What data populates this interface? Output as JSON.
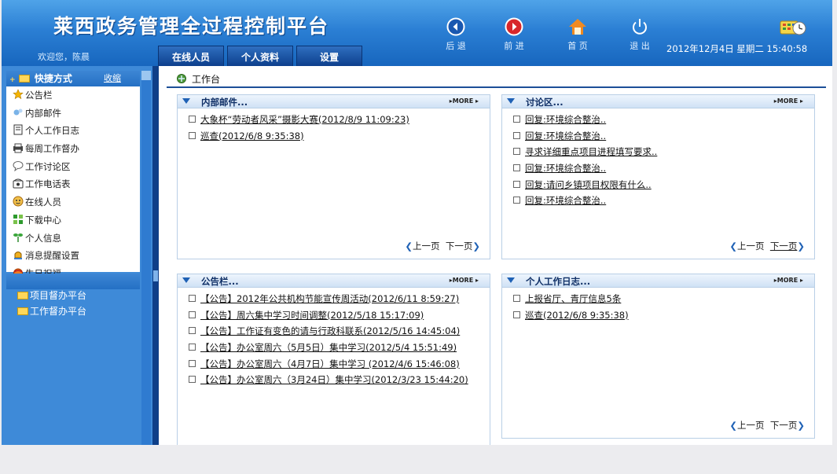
{
  "header": {
    "title": "莱西政务管理全过程控制平台",
    "welcome": "欢迎您，陈晨",
    "datetime": "2012年12月4日 星期二 15:40:58",
    "tabs": [
      {
        "label": "在线人员"
      },
      {
        "label": "个人资料"
      },
      {
        "label": "设置"
      }
    ],
    "tools": [
      {
        "label": "后 退",
        "icon": "back-arrow-icon"
      },
      {
        "label": "前 进",
        "icon": "forward-arrow-icon"
      },
      {
        "label": "首 页",
        "icon": "home-icon"
      },
      {
        "label": "退 出",
        "icon": "power-icon"
      }
    ],
    "calendar_icon": "calendar-clock-icon"
  },
  "sidebar": {
    "shortcuts_title": "快捷方式",
    "collapse_label": "收缩",
    "items": [
      {
        "label": "公告栏",
        "icon": "star-icon"
      },
      {
        "label": "内部邮件",
        "icon": "mail-icon"
      },
      {
        "label": "个人工作日志",
        "icon": "journal-icon"
      },
      {
        "label": "每周工作督办",
        "icon": "printer-icon"
      },
      {
        "label": "工作讨论区",
        "icon": "speech-bubble-icon"
      },
      {
        "label": "工作电话表",
        "icon": "phone-icon"
      },
      {
        "label": "在线人员",
        "icon": "people-icon"
      },
      {
        "label": "下载中心",
        "icon": "grid-icon"
      },
      {
        "label": "个人信息",
        "icon": "plant-icon"
      },
      {
        "label": "消息提醒设置",
        "icon": "bell-icon"
      },
      {
        "label": "生日祝福",
        "icon": "gift-icon"
      }
    ],
    "sections": [
      {
        "label": "项目督办平台"
      },
      {
        "label": "工作督办平台"
      }
    ]
  },
  "main": {
    "title": "工作台",
    "boxes": [
      {
        "title": "内部邮件...",
        "more": "MORE",
        "entries": [
          "大象杯“劳动者风采”摄影大赛(2012/8/9 11:09:23)",
          "巡查(2012/6/8 9:35:38)"
        ],
        "pager": {
          "prev": "上一页",
          "next": "下一页"
        }
      },
      {
        "title": "讨论区...",
        "more": "MORE",
        "entries": [
          "回复:环境综合整治..",
          "回复:环境综合整治..",
          "寻求详细重点项目进程填写要求..",
          "回复:环境综合整治..",
          "回复:请问乡镇项目权限有什么..",
          "回复:环境综合整治.."
        ],
        "pager": {
          "prev": "上一页",
          "next": "下一页"
        }
      },
      {
        "title": "公告栏...",
        "more": "MORE",
        "entries": [
          "【公告】2012年公共机构节能宣传周活动(2012/6/11 8:59:27)",
          "【公告】周六集中学习时间调整(2012/5/18 15:17:09)",
          "【公告】工作证有变色的请与行政科联系(2012/5/16 14:45:04)",
          "【公告】办公室周六（5月5日）集中学习(2012/5/4 15:51:49)",
          "【公告】办公室周六（4月7日）集中学习 (2012/4/6 15:46:08)",
          "【公告】办公室周六（3月24日）集中学习(2012/3/23 15:44:20)"
        ]
      },
      {
        "title": "个人工作日志...",
        "more": "MORE",
        "entries": [
          "上报省厅、青厅信息5条",
          "巡查(2012/6/8 9:35:38)"
        ],
        "pager": {
          "prev": "上一页",
          "next": "下一页"
        }
      }
    ]
  }
}
